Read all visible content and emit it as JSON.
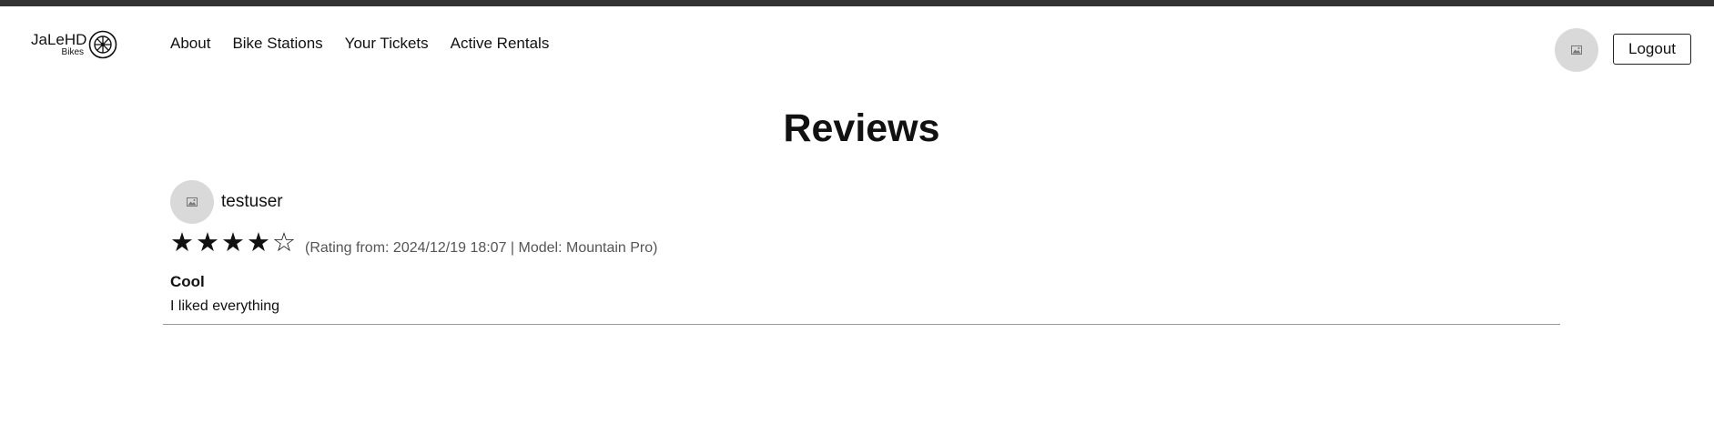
{
  "header": {
    "logo_main": "JaLeHD",
    "logo_sub": "Bikes",
    "nav": [
      {
        "label": "About"
      },
      {
        "label": "Bike Stations"
      },
      {
        "label": "Your Tickets"
      },
      {
        "label": "Active Rentals"
      }
    ],
    "logout_label": "Logout"
  },
  "page": {
    "title": "Reviews"
  },
  "reviews": [
    {
      "username": "testuser",
      "rating": 4,
      "max_rating": 5,
      "meta": "(Rating from: 2024/12/19 18:07 | Model: Mountain Pro)",
      "title": "Cool",
      "body": "I liked everything"
    }
  ],
  "colors": {
    "topbar": "#333333",
    "avatar_bg": "#d9d9d9",
    "text": "#111111",
    "meta_text": "#555555",
    "divider": "#999999"
  }
}
